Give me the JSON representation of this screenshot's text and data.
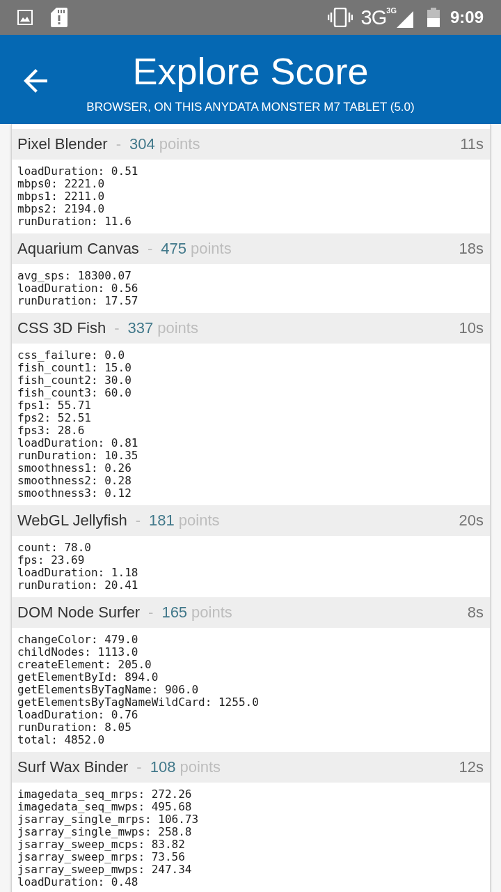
{
  "status_bar": {
    "network": "3G",
    "network_badge": "3G",
    "time": "9:09"
  },
  "app_bar": {
    "title": "Explore Score",
    "subtitle": "BROWSER, ON THIS ANYDATA MONSTER M7 TABLET (5.0)"
  },
  "tests": [
    {
      "name": "Pixel Blender",
      "separator": "-",
      "score": "304",
      "unit": "points",
      "duration": "11s",
      "metrics": [
        "loadDuration: 0.51",
        "mbps0: 2221.0",
        "mbps1: 2211.0",
        "mbps2: 2194.0",
        "runDuration: 11.6"
      ]
    },
    {
      "name": "Aquarium Canvas",
      "separator": "-",
      "score": "475",
      "unit": "points",
      "duration": "18s",
      "metrics": [
        "avg_sps: 18300.07",
        "loadDuration: 0.56",
        "runDuration: 17.57"
      ]
    },
    {
      "name": "CSS 3D Fish",
      "separator": "-",
      "score": "337",
      "unit": "points",
      "duration": "10s",
      "metrics": [
        "css_failure: 0.0",
        "fish_count1: 15.0",
        "fish_count2: 30.0",
        "fish_count3: 60.0",
        "fps1: 55.71",
        "fps2: 52.51",
        "fps3: 28.6",
        "loadDuration: 0.81",
        "runDuration: 10.35",
        "smoothness1: 0.26",
        "smoothness2: 0.28",
        "smoothness3: 0.12"
      ]
    },
    {
      "name": "WebGL Jellyfish",
      "separator": "-",
      "score": "181",
      "unit": "points",
      "duration": "20s",
      "metrics": [
        "count: 78.0",
        "fps: 23.69",
        "loadDuration: 1.18",
        "runDuration: 20.41"
      ]
    },
    {
      "name": "DOM Node Surfer",
      "separator": "-",
      "score": "165",
      "unit": "points",
      "duration": "8s",
      "metrics": [
        "changeColor: 479.0",
        "childNodes: 1113.0",
        "createElement: 205.0",
        "getElementById: 894.0",
        "getElementsByTagName: 906.0",
        "getElementsByTagNameWildCard: 1255.0",
        "loadDuration: 0.76",
        "runDuration: 8.05",
        "total: 4852.0"
      ]
    },
    {
      "name": "Surf Wax Binder",
      "separator": "-",
      "score": "108",
      "unit": "points",
      "duration": "12s",
      "metrics": [
        "imagedata_seq_mrps: 272.26",
        "imagedata_seq_mwps: 495.68",
        "jsarray_single_mrps: 106.73",
        "jsarray_single_mwps: 258.8",
        "jsarray_sweep_mcps: 83.82",
        "jsarray_sweep_mrps: 73.56",
        "jsarray_sweep_mwps: 247.34",
        "loadDuration: 0.48"
      ]
    }
  ]
}
